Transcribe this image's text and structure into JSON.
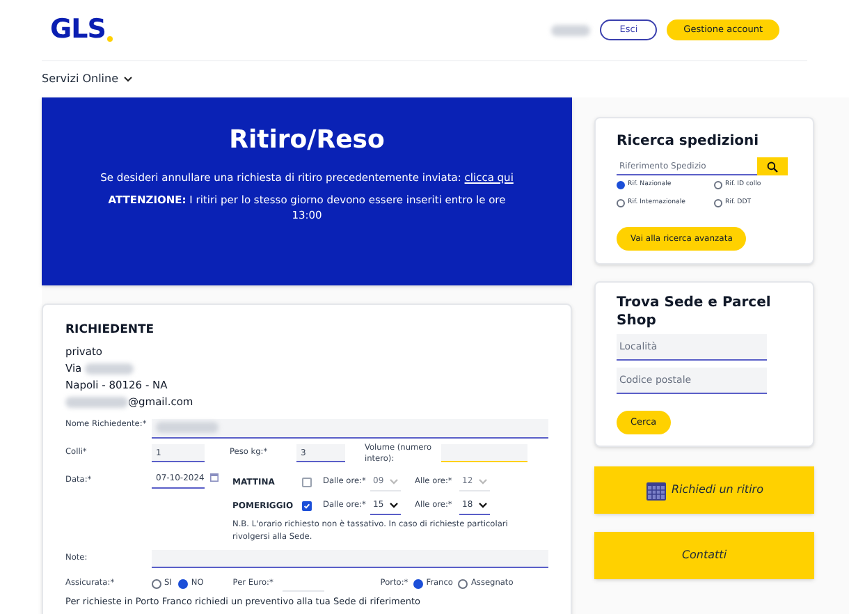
{
  "header": {
    "logo": "GLS",
    "logout_button": "Esci",
    "account_button": "Gestione account"
  },
  "nav": {
    "label": "Servizi Online"
  },
  "banner": {
    "title": "Ritiro/Reso",
    "cancel_text": "Se desideri annullare una richiesta di ritiro precedentemente inviata:",
    "cancel_link": "clicca qui",
    "notice": "**ATTENZIONE:** I ritiri per lo stesso giorno devono essere inseriti entro le ore 13:00"
  },
  "requester": {
    "heading": "RICHIEDENTE",
    "lines": [
      {
        "text": "privato",
        "kind": "plain"
      },
      {
        "text": "Via",
        "kind": "masked_after"
      },
      {
        "text": "Napoli - 80126 - NA",
        "kind": "plain"
      },
      {
        "text": "@gmail.com",
        "kind": "masked_before"
      }
    ]
  },
  "form": {
    "name_label": "Nome Richiedente:*",
    "colli_label": "Colli*",
    "colli_value": "1",
    "weight_label": "Peso kg:*",
    "weight_value": "3",
    "volume_label": "Volume (numero intero):",
    "date_label": "Data:*",
    "date_value": "07-10-2024",
    "slots": [
      {
        "label": "MATTINA",
        "checked": false,
        "from_label": "Dalle ore:*",
        "from_value": "09",
        "to_label": "Alle ore:*",
        "to_value": "12"
      },
      {
        "label": "POMERIGGIO",
        "checked": true,
        "from_label": "Dalle ore:*",
        "from_value": "15",
        "to_label": "Alle ore:*",
        "to_value": "18"
      }
    ],
    "slot_note": "N.B. L'orario richiesto non è tassativo. In caso di richieste particolari rivolgersi alla Sede.",
    "notes_label": "Note:",
    "insured_label": "Assicurata:*",
    "insured_options": [
      {
        "label": "SI",
        "selected": false
      },
      {
        "label": "NO",
        "selected": true
      }
    ],
    "euro_label": "Per Euro:*",
    "port_label": "Porto:*",
    "port_options": [
      {
        "label": "Franco",
        "selected": true
      },
      {
        "label": "Assegnato",
        "selected": false
      }
    ],
    "footer_text": "Per richieste in Porto Franco richiedi un preventivo alla tua Sede di riferimento"
  },
  "search_card": {
    "title": "Ricerca spedizioni",
    "placeholder": "Riferimento Spedizio",
    "options": [
      {
        "label": "Rif. Nazionale",
        "selected": true
      },
      {
        "label": "Rif. ID collo",
        "selected": false
      },
      {
        "label": "Rif. Internazionale",
        "selected": false
      },
      {
        "label": "Rif. DDT",
        "selected": false
      }
    ],
    "button": "Vai alla ricerca avanzata"
  },
  "find_card": {
    "title": "Trova Sede e Parcel Shop",
    "fields": [
      {
        "placeholder": "Località"
      },
      {
        "placeholder": "Codice postale"
      }
    ],
    "button": "Cerca"
  },
  "actions": [
    {
      "label": "Richiedi un ritiro",
      "kind": "calendar"
    },
    {
      "label": "Contatti",
      "kind": "plain"
    }
  ]
}
